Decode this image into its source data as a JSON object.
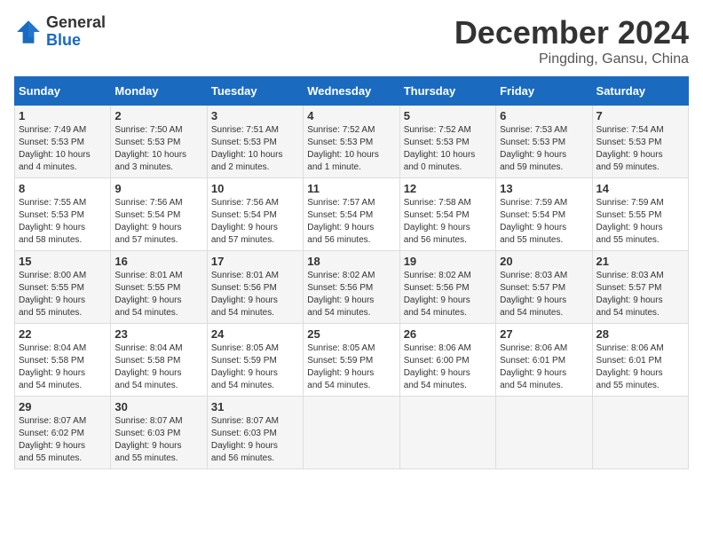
{
  "header": {
    "logo_general": "General",
    "logo_blue": "Blue",
    "month_title": "December 2024",
    "location": "Pingding, Gansu, China"
  },
  "weekdays": [
    "Sunday",
    "Monday",
    "Tuesday",
    "Wednesday",
    "Thursday",
    "Friday",
    "Saturday"
  ],
  "weeks": [
    [
      {
        "day": "1",
        "info": "Sunrise: 7:49 AM\nSunset: 5:53 PM\nDaylight: 10 hours\nand 4 minutes."
      },
      {
        "day": "2",
        "info": "Sunrise: 7:50 AM\nSunset: 5:53 PM\nDaylight: 10 hours\nand 3 minutes."
      },
      {
        "day": "3",
        "info": "Sunrise: 7:51 AM\nSunset: 5:53 PM\nDaylight: 10 hours\nand 2 minutes."
      },
      {
        "day": "4",
        "info": "Sunrise: 7:52 AM\nSunset: 5:53 PM\nDaylight: 10 hours\nand 1 minute."
      },
      {
        "day": "5",
        "info": "Sunrise: 7:52 AM\nSunset: 5:53 PM\nDaylight: 10 hours\nand 0 minutes."
      },
      {
        "day": "6",
        "info": "Sunrise: 7:53 AM\nSunset: 5:53 PM\nDaylight: 9 hours\nand 59 minutes."
      },
      {
        "day": "7",
        "info": "Sunrise: 7:54 AM\nSunset: 5:53 PM\nDaylight: 9 hours\nand 59 minutes."
      }
    ],
    [
      {
        "day": "8",
        "info": "Sunrise: 7:55 AM\nSunset: 5:53 PM\nDaylight: 9 hours\nand 58 minutes."
      },
      {
        "day": "9",
        "info": "Sunrise: 7:56 AM\nSunset: 5:54 PM\nDaylight: 9 hours\nand 57 minutes."
      },
      {
        "day": "10",
        "info": "Sunrise: 7:56 AM\nSunset: 5:54 PM\nDaylight: 9 hours\nand 57 minutes."
      },
      {
        "day": "11",
        "info": "Sunrise: 7:57 AM\nSunset: 5:54 PM\nDaylight: 9 hours\nand 56 minutes."
      },
      {
        "day": "12",
        "info": "Sunrise: 7:58 AM\nSunset: 5:54 PM\nDaylight: 9 hours\nand 56 minutes."
      },
      {
        "day": "13",
        "info": "Sunrise: 7:59 AM\nSunset: 5:54 PM\nDaylight: 9 hours\nand 55 minutes."
      },
      {
        "day": "14",
        "info": "Sunrise: 7:59 AM\nSunset: 5:55 PM\nDaylight: 9 hours\nand 55 minutes."
      }
    ],
    [
      {
        "day": "15",
        "info": "Sunrise: 8:00 AM\nSunset: 5:55 PM\nDaylight: 9 hours\nand 55 minutes."
      },
      {
        "day": "16",
        "info": "Sunrise: 8:01 AM\nSunset: 5:55 PM\nDaylight: 9 hours\nand 54 minutes."
      },
      {
        "day": "17",
        "info": "Sunrise: 8:01 AM\nSunset: 5:56 PM\nDaylight: 9 hours\nand 54 minutes."
      },
      {
        "day": "18",
        "info": "Sunrise: 8:02 AM\nSunset: 5:56 PM\nDaylight: 9 hours\nand 54 minutes."
      },
      {
        "day": "19",
        "info": "Sunrise: 8:02 AM\nSunset: 5:56 PM\nDaylight: 9 hours\nand 54 minutes."
      },
      {
        "day": "20",
        "info": "Sunrise: 8:03 AM\nSunset: 5:57 PM\nDaylight: 9 hours\nand 54 minutes."
      },
      {
        "day": "21",
        "info": "Sunrise: 8:03 AM\nSunset: 5:57 PM\nDaylight: 9 hours\nand 54 minutes."
      }
    ],
    [
      {
        "day": "22",
        "info": "Sunrise: 8:04 AM\nSunset: 5:58 PM\nDaylight: 9 hours\nand 54 minutes."
      },
      {
        "day": "23",
        "info": "Sunrise: 8:04 AM\nSunset: 5:58 PM\nDaylight: 9 hours\nand 54 minutes."
      },
      {
        "day": "24",
        "info": "Sunrise: 8:05 AM\nSunset: 5:59 PM\nDaylight: 9 hours\nand 54 minutes."
      },
      {
        "day": "25",
        "info": "Sunrise: 8:05 AM\nSunset: 5:59 PM\nDaylight: 9 hours\nand 54 minutes."
      },
      {
        "day": "26",
        "info": "Sunrise: 8:06 AM\nSunset: 6:00 PM\nDaylight: 9 hours\nand 54 minutes."
      },
      {
        "day": "27",
        "info": "Sunrise: 8:06 AM\nSunset: 6:01 PM\nDaylight: 9 hours\nand 54 minutes."
      },
      {
        "day": "28",
        "info": "Sunrise: 8:06 AM\nSunset: 6:01 PM\nDaylight: 9 hours\nand 55 minutes."
      }
    ],
    [
      {
        "day": "29",
        "info": "Sunrise: 8:07 AM\nSunset: 6:02 PM\nDaylight: 9 hours\nand 55 minutes."
      },
      {
        "day": "30",
        "info": "Sunrise: 8:07 AM\nSunset: 6:03 PM\nDaylight: 9 hours\nand 55 minutes."
      },
      {
        "day": "31",
        "info": "Sunrise: 8:07 AM\nSunset: 6:03 PM\nDaylight: 9 hours\nand 56 minutes."
      },
      {
        "day": "",
        "info": ""
      },
      {
        "day": "",
        "info": ""
      },
      {
        "day": "",
        "info": ""
      },
      {
        "day": "",
        "info": ""
      }
    ]
  ]
}
